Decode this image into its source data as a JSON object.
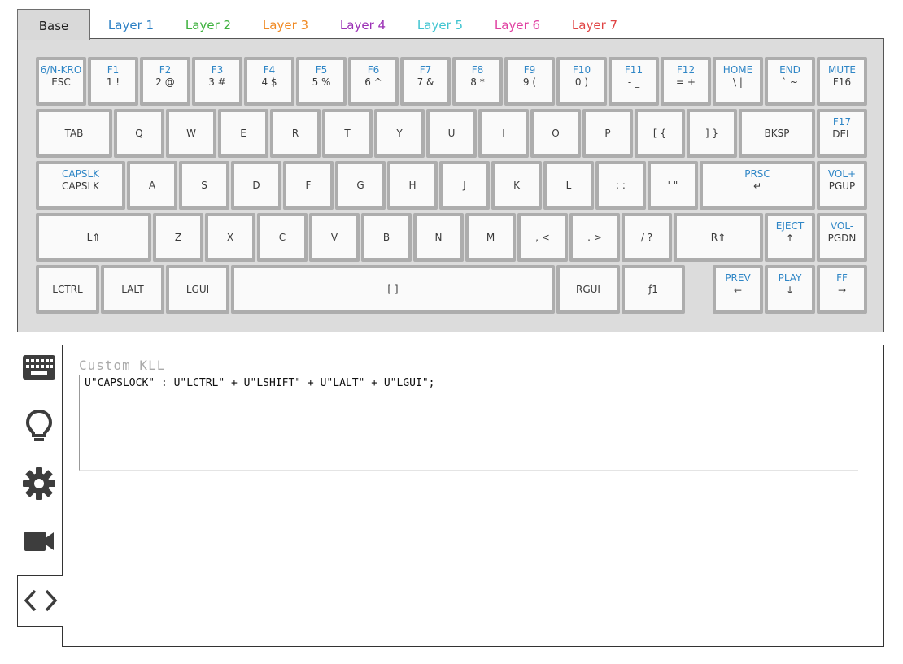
{
  "tabs": [
    {
      "label": "Base",
      "color": "#222222"
    },
    {
      "label": "Layer 1",
      "color": "#2a7fc4"
    },
    {
      "label": "Layer 2",
      "color": "#3cb03c"
    },
    {
      "label": "Layer 3",
      "color": "#f08a24"
    },
    {
      "label": "Layer 4",
      "color": "#9b2fb5"
    },
    {
      "label": "Layer 5",
      "color": "#3fc4d0"
    },
    {
      "label": "Layer 6",
      "color": "#e03fa0"
    },
    {
      "label": "Layer 7",
      "color": "#e04444"
    }
  ],
  "keyboard": {
    "rows": [
      [
        {
          "top": "6/N-KRO",
          "bot": "ESC"
        },
        {
          "top": "F1",
          "bot": "1 !"
        },
        {
          "top": "F2",
          "bot": "2 @"
        },
        {
          "top": "F3",
          "bot": "3 #"
        },
        {
          "top": "F4",
          "bot": "4 $"
        },
        {
          "top": "F5",
          "bot": "5 %"
        },
        {
          "top": "F6",
          "bot": "6 ^"
        },
        {
          "top": "F7",
          "bot": "7 &"
        },
        {
          "top": "F8",
          "bot": "8 *"
        },
        {
          "top": "F9",
          "bot": "9 ("
        },
        {
          "top": "F10",
          "bot": "0 )"
        },
        {
          "top": "F11",
          "bot": "- _"
        },
        {
          "top": "F12",
          "bot": "= +"
        },
        {
          "top": "HOME",
          "bot": "\\ |"
        },
        {
          "top": "END",
          "bot": "` ~"
        },
        {
          "top": "MUTE",
          "bot": "F16"
        }
      ],
      [
        {
          "top": "",
          "bot": "TAB"
        },
        {
          "top": "",
          "bot": "Q"
        },
        {
          "top": "",
          "bot": "W"
        },
        {
          "top": "",
          "bot": "E"
        },
        {
          "top": "",
          "bot": "R"
        },
        {
          "top": "",
          "bot": "T"
        },
        {
          "top": "",
          "bot": "Y"
        },
        {
          "top": "",
          "bot": "U"
        },
        {
          "top": "",
          "bot": "I"
        },
        {
          "top": "",
          "bot": "O"
        },
        {
          "top": "",
          "bot": "P"
        },
        {
          "top": "",
          "bot": "[ {"
        },
        {
          "top": "",
          "bot": "] }"
        },
        {
          "top": "",
          "bot": "BKSP"
        },
        {
          "top": "F17",
          "bot": "DEL"
        }
      ],
      [
        {
          "top": "CAPSLK",
          "bot": "CAPSLK"
        },
        {
          "top": "",
          "bot": "A"
        },
        {
          "top": "",
          "bot": "S"
        },
        {
          "top": "",
          "bot": "D"
        },
        {
          "top": "",
          "bot": "F"
        },
        {
          "top": "",
          "bot": "G"
        },
        {
          "top": "",
          "bot": "H"
        },
        {
          "top": "",
          "bot": "J"
        },
        {
          "top": "",
          "bot": "K"
        },
        {
          "top": "",
          "bot": "L"
        },
        {
          "top": "",
          "bot": "; :"
        },
        {
          "top": "",
          "bot": "' \""
        },
        {
          "top": "PRSC",
          "bot": "↵"
        },
        {
          "top": "VOL+",
          "bot": "PGUP"
        }
      ],
      [
        {
          "top": "",
          "bot": "L⇑"
        },
        {
          "top": "",
          "bot": "Z"
        },
        {
          "top": "",
          "bot": "X"
        },
        {
          "top": "",
          "bot": "C"
        },
        {
          "top": "",
          "bot": "V"
        },
        {
          "top": "",
          "bot": "B"
        },
        {
          "top": "",
          "bot": "N"
        },
        {
          "top": "",
          "bot": "M"
        },
        {
          "top": "",
          "bot": ", <"
        },
        {
          "top": "",
          "bot": ". >"
        },
        {
          "top": "",
          "bot": "/ ?"
        },
        {
          "top": "",
          "bot": "R⇑"
        },
        {
          "top": "EJECT",
          "bot": "↑"
        },
        {
          "top": "VOL-",
          "bot": "PGDN"
        }
      ],
      [
        {
          "top": "",
          "bot": "LCTRL"
        },
        {
          "top": "",
          "bot": "LALT"
        },
        {
          "top": "",
          "bot": "LGUI"
        },
        {
          "top": "",
          "bot": "[ ]"
        },
        {
          "top": "",
          "bot": "RGUI"
        },
        {
          "top": "",
          "bot": "ƒ1"
        },
        {
          "top": "PREV",
          "bot": "←"
        },
        {
          "top": "PLAY",
          "bot": "↓"
        },
        {
          "top": "FF",
          "bot": "→"
        }
      ]
    ]
  },
  "sidebar": {
    "icons": [
      "keyboard-icon",
      "lightbulb-icon",
      "gear-icon",
      "video-camera-icon",
      "code-icon"
    ],
    "icon_color": "#3d3d3d"
  },
  "editor": {
    "title": "Custom KLL",
    "code": "U\"CAPSLOCK\" : U\"LCTRL\" + U\"LSHIFT\" + U\"LALT\" + U\"LGUI\";"
  }
}
